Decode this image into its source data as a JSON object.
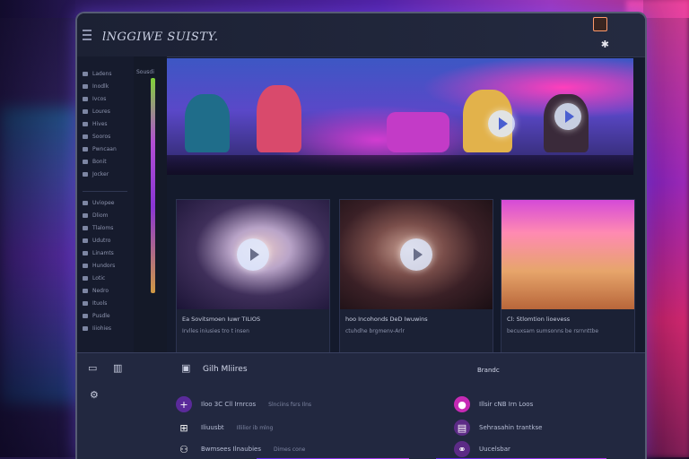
{
  "app": {
    "title": "lNGGIWE SUISTY."
  },
  "sidebar": {
    "items": [
      {
        "label": "Ladens"
      },
      {
        "label": "Inodlk"
      },
      {
        "label": "Ivcos"
      },
      {
        "label": "Loures"
      },
      {
        "label": "Hives"
      },
      {
        "label": "Sooros"
      },
      {
        "label": "Pwncaan"
      },
      {
        "label": "Bonit"
      },
      {
        "label": "Jocker"
      },
      {
        "label": "Uviopee"
      },
      {
        "label": "Dliom"
      },
      {
        "label": "Tlaloms"
      },
      {
        "label": "Udutro"
      },
      {
        "label": "Linamts"
      },
      {
        "label": "Hundors"
      },
      {
        "label": "Lotic"
      },
      {
        "label": "Nedro"
      },
      {
        "label": "Ituols"
      },
      {
        "label": "Pusdle"
      },
      {
        "label": "Iiiohies"
      }
    ],
    "secondary_label": "Sousdi"
  },
  "hero": {
    "accent": "#d23cd0"
  },
  "cards": [
    {
      "title": "Ea Sovitsmoen Iuwr TILIOS",
      "desc": "Irvlles iniusies tro t insen"
    },
    {
      "title": "hoo Incohonds DeD Iwuwins",
      "desc": "ctuhdhe brgmenv-Arlr"
    },
    {
      "title": "Cl: Stlomtion lioevess",
      "desc": "becuxsam sumsonns be rsrnnttbe"
    }
  ],
  "bottom_panel": {
    "tab_label": "Gilh Mliires",
    "right_label": "Brandc",
    "rows": [
      {
        "icon_color": "#5a2a9a",
        "text": "Iloo 3C Cll Irnrcos",
        "sub": "Slnciins fsrs Ilns",
        "right_text": "Illsir cNB Irn Loos"
      },
      {
        "icon_color": "transparent",
        "text": "Iliuusbt",
        "sub": "Illilior ib mlng",
        "right_text": "Sehrasahin trantkse"
      },
      {
        "icon_color": "transparent",
        "text": "Bwmsees Ilnaubies",
        "sub": "Dimes cone",
        "right_text": "Uucelsbar"
      }
    ]
  }
}
